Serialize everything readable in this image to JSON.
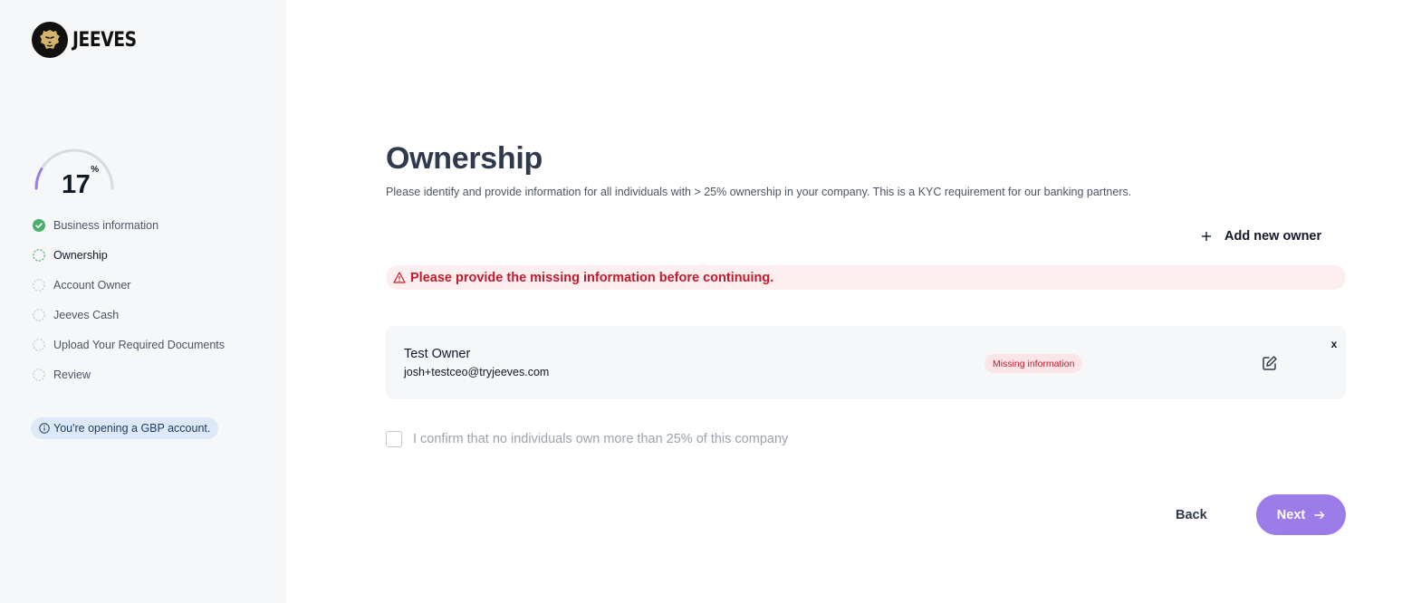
{
  "brand": {
    "name": "JEEVES",
    "accent": "#9b7ce8",
    "success": "#4caf6a",
    "error": "#c5192d"
  },
  "progress": {
    "percent_value": 17,
    "percent_text": "17",
    "percent_sign": "%"
  },
  "steps": [
    {
      "label": "Business information",
      "status": "complete",
      "icon": "check-circle-icon"
    },
    {
      "label": "Ownership",
      "status": "active",
      "icon": "dashed-circle-icon"
    },
    {
      "label": "Account Owner",
      "status": "pending",
      "icon": "dashed-circle-icon"
    },
    {
      "label": "Jeeves Cash",
      "status": "pending",
      "icon": "dashed-circle-icon"
    },
    {
      "label": "Upload Your Required Documents",
      "status": "pending",
      "icon": "dashed-circle-icon"
    },
    {
      "label": "Review",
      "status": "pending",
      "icon": "dashed-circle-icon"
    }
  ],
  "account_notice": "You're opening a GBP account.",
  "main": {
    "title": "Ownership",
    "description": "Please identify and provide information for all individuals with > 25% ownership in your company. This is a KYC requirement for our banking partners.",
    "add_owner_label": "Add new owner",
    "error_message": "Please provide the missing information before continuing.",
    "owners": [
      {
        "name": "Test Owner",
        "email": "josh+testceo@tryjeeves.com",
        "status": "Missing information",
        "remove_label": "x"
      }
    ],
    "confirm_label": "I confirm that no individuals own more than 25% of this company",
    "confirm_checked": false,
    "back_label": "Back",
    "next_label": "Next"
  }
}
